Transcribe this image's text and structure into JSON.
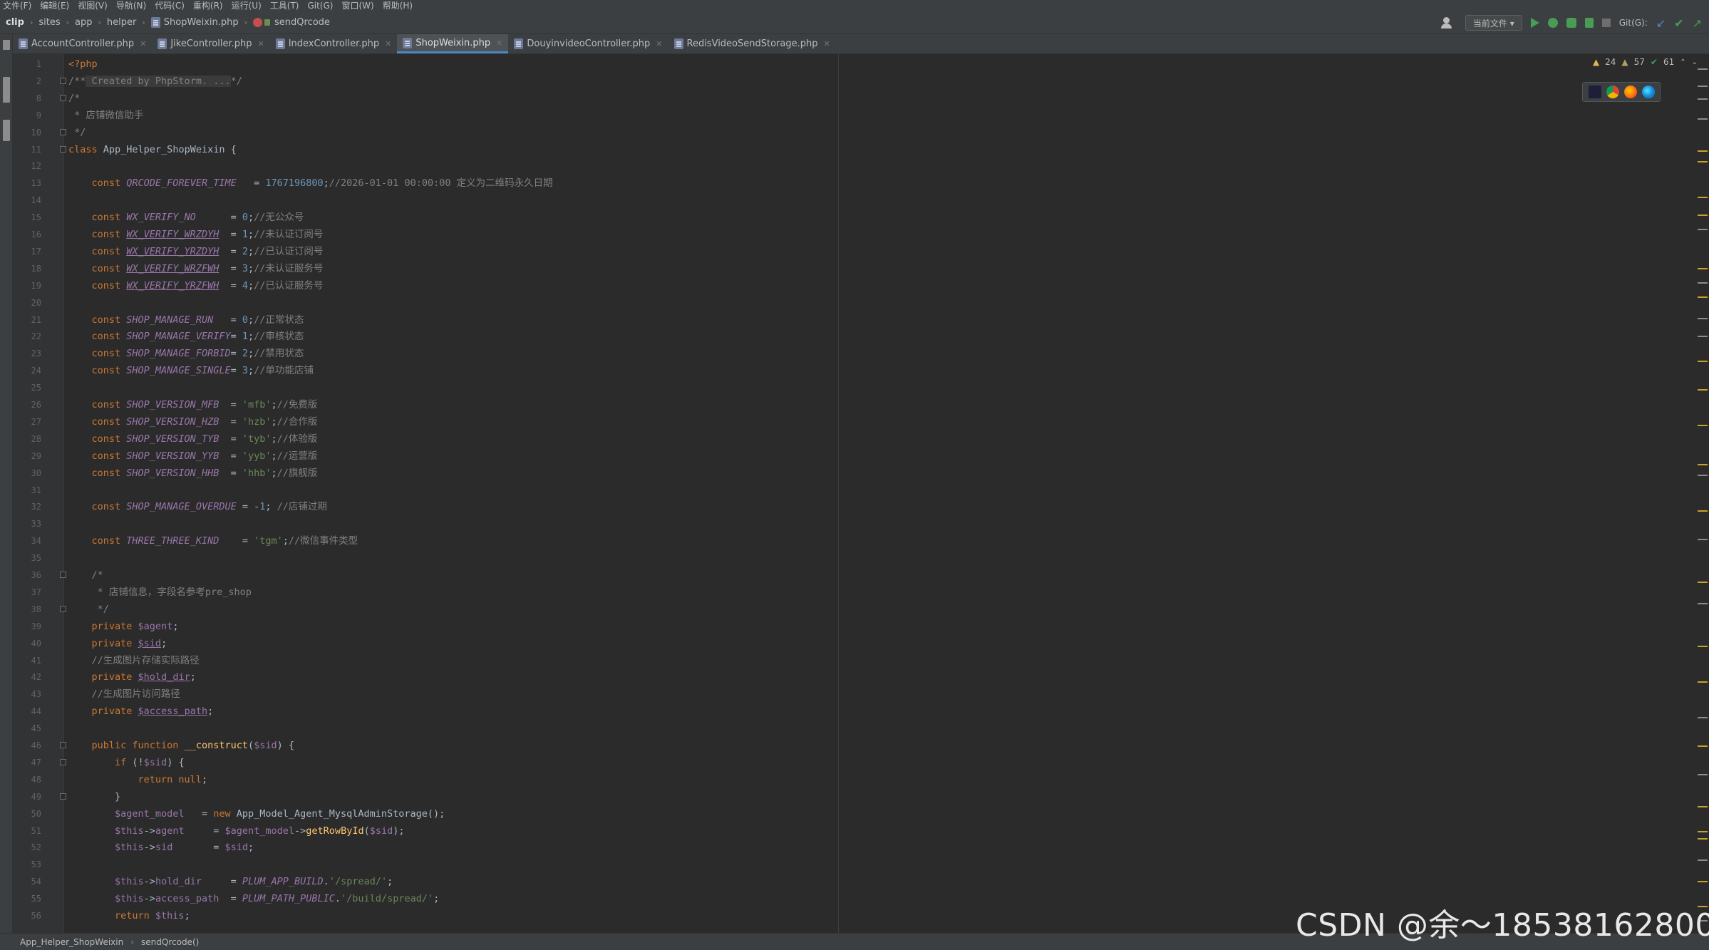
{
  "menu": [
    "文件(F)",
    "编辑(E)",
    "视图(V)",
    "导航(N)",
    "代码(C)",
    "重构(R)",
    "运行(U)",
    "工具(T)",
    "Git(G)",
    "窗口(W)",
    "帮助(H)"
  ],
  "breadcrumb": {
    "project": "clip",
    "path": [
      "sites",
      "app",
      "helper"
    ],
    "file": "ShopWeixin.php",
    "method": "sendQrcode"
  },
  "toolbar": {
    "run_config": "当前文件 ▾",
    "git_label": "Git(G):"
  },
  "tabs": [
    {
      "label": "AccountController.php",
      "active": false
    },
    {
      "label": "JikeController.php",
      "active": false
    },
    {
      "label": "IndexController.php",
      "active": false
    },
    {
      "label": "ShopWeixin.php",
      "active": true
    },
    {
      "label": "DouyinvideoController.php",
      "active": false
    },
    {
      "label": "RedisVideoSendStorage.php",
      "active": false
    }
  ],
  "inspections": {
    "warnings": "24",
    "weak_warnings": "57",
    "typos": "61"
  },
  "line_numbers": [
    "1",
    "2",
    "8",
    "9",
    "10",
    "11",
    "12",
    "13",
    "14",
    "15",
    "16",
    "17",
    "18",
    "19",
    "20",
    "21",
    "22",
    "23",
    "24",
    "25",
    "26",
    "27",
    "28",
    "29",
    "30",
    "31",
    "32",
    "33",
    "34",
    "35",
    "36",
    "37",
    "38",
    "39",
    "40",
    "41",
    "42",
    "43",
    "44",
    "45",
    "46",
    "47",
    "48",
    "49",
    "50",
    "51",
    "52",
    "53",
    "54",
    "55",
    "56"
  ],
  "code_lines": [
    [
      [
        "kw",
        "<?php"
      ]
    ],
    [
      [
        "cmt",
        "/**"
      ],
      [
        "fold-cmt",
        " Created by PhpStorm. ..."
      ],
      [
        "cmt",
        "*/"
      ]
    ],
    [
      [
        "cmt",
        "/*"
      ]
    ],
    [
      [
        "cmt",
        " * 店铺微信助手"
      ]
    ],
    [
      [
        "cmt",
        " */"
      ]
    ],
    [
      [
        "kw",
        "class "
      ],
      [
        "pt",
        "App_Helper_ShopWeixin {"
      ]
    ],
    [],
    [
      [
        "kw",
        "    const "
      ],
      [
        "cst",
        "QRCODE_FOREVER_TIME"
      ],
      [
        "pt",
        "   = "
      ],
      [
        "num",
        "1767196800"
      ],
      [
        "pt",
        ";"
      ],
      [
        "cmt",
        "//2026-01-01 00:00:00 定义为二维码永久日期"
      ]
    ],
    [],
    [
      [
        "kw",
        "    const "
      ],
      [
        "cst",
        "WX_VERIFY_NO"
      ],
      [
        "pt",
        "      = "
      ],
      [
        "num",
        "0"
      ],
      [
        "pt",
        ";"
      ],
      [
        "cmt",
        "//无公众号"
      ]
    ],
    [
      [
        "kw",
        "    const "
      ],
      [
        "cst und",
        "WX_VERIFY_WRZDYH"
      ],
      [
        "pt",
        "  = "
      ],
      [
        "num",
        "1"
      ],
      [
        "pt",
        ";"
      ],
      [
        "cmt",
        "//未认证订阅号"
      ]
    ],
    [
      [
        "kw",
        "    const "
      ],
      [
        "cst und",
        "WX_VERIFY_YRZDYH"
      ],
      [
        "pt",
        "  = "
      ],
      [
        "num",
        "2"
      ],
      [
        "pt",
        ";"
      ],
      [
        "cmt",
        "//已认证订阅号"
      ]
    ],
    [
      [
        "kw",
        "    const "
      ],
      [
        "cst und",
        "WX_VERIFY_WRZFWH"
      ],
      [
        "pt",
        "  = "
      ],
      [
        "num",
        "3"
      ],
      [
        "pt",
        ";"
      ],
      [
        "cmt",
        "//未认证服务号"
      ]
    ],
    [
      [
        "kw",
        "    const "
      ],
      [
        "cst und",
        "WX_VERIFY_YRZFWH"
      ],
      [
        "pt",
        "  = "
      ],
      [
        "num",
        "4"
      ],
      [
        "pt",
        ";"
      ],
      [
        "cmt",
        "//已认证服务号"
      ]
    ],
    [],
    [
      [
        "kw",
        "    const "
      ],
      [
        "cst",
        "SHOP_MANAGE_RUN"
      ],
      [
        "pt",
        "   = "
      ],
      [
        "num",
        "0"
      ],
      [
        "pt",
        ";"
      ],
      [
        "cmt",
        "//正常状态"
      ]
    ],
    [
      [
        "kw",
        "    const "
      ],
      [
        "cst",
        "SHOP_MANAGE_VERIFY"
      ],
      [
        "pt",
        "= "
      ],
      [
        "num",
        "1"
      ],
      [
        "pt",
        ";"
      ],
      [
        "cmt",
        "//审核状态"
      ]
    ],
    [
      [
        "kw",
        "    const "
      ],
      [
        "cst",
        "SHOP_MANAGE_FORBID"
      ],
      [
        "pt",
        "= "
      ],
      [
        "num",
        "2"
      ],
      [
        "pt",
        ";"
      ],
      [
        "cmt",
        "//禁用状态"
      ]
    ],
    [
      [
        "kw",
        "    const "
      ],
      [
        "cst",
        "SHOP_MANAGE_SINGLE"
      ],
      [
        "pt",
        "= "
      ],
      [
        "num",
        "3"
      ],
      [
        "pt",
        ";"
      ],
      [
        "cmt",
        "//单功能店铺"
      ]
    ],
    [],
    [
      [
        "kw",
        "    const "
      ],
      [
        "cst",
        "SHOP_VERSION_MFB"
      ],
      [
        "pt",
        "  = "
      ],
      [
        "str",
        "'mfb'"
      ],
      [
        "pt",
        ";"
      ],
      [
        "cmt",
        "//免费版"
      ]
    ],
    [
      [
        "kw",
        "    const "
      ],
      [
        "cst",
        "SHOP_VERSION_HZB"
      ],
      [
        "pt",
        "  = "
      ],
      [
        "str",
        "'hzb'"
      ],
      [
        "pt",
        ";"
      ],
      [
        "cmt",
        "//合作版"
      ]
    ],
    [
      [
        "kw",
        "    const "
      ],
      [
        "cst",
        "SHOP_VERSION_TYB"
      ],
      [
        "pt",
        "  = "
      ],
      [
        "str",
        "'tyb'"
      ],
      [
        "pt",
        ";"
      ],
      [
        "cmt",
        "//体验版"
      ]
    ],
    [
      [
        "kw",
        "    const "
      ],
      [
        "cst",
        "SHOP_VERSION_YYB"
      ],
      [
        "pt",
        "  = "
      ],
      [
        "str",
        "'yyb'"
      ],
      [
        "pt",
        ";"
      ],
      [
        "cmt",
        "//运营版"
      ]
    ],
    [
      [
        "kw",
        "    const "
      ],
      [
        "cst",
        "SHOP_VERSION_HHB"
      ],
      [
        "pt",
        "  = "
      ],
      [
        "str",
        "'hhb'"
      ],
      [
        "pt",
        ";"
      ],
      [
        "cmt",
        "//旗舰版"
      ]
    ],
    [],
    [
      [
        "kw",
        "    const "
      ],
      [
        "cst",
        "SHOP_MANAGE_OVERDUE"
      ],
      [
        "pt",
        " = -"
      ],
      [
        "num",
        "1"
      ],
      [
        "pt",
        "; "
      ],
      [
        "cmt",
        "//店铺过期"
      ]
    ],
    [],
    [
      [
        "kw",
        "    const "
      ],
      [
        "cst",
        "THREE_THREE_KIND"
      ],
      [
        "pt",
        "    = "
      ],
      [
        "str",
        "'tgm'"
      ],
      [
        "pt",
        ";"
      ],
      [
        "cmt",
        "//微信事件类型"
      ]
    ],
    [],
    [
      [
        "cmt",
        "    /*"
      ]
    ],
    [
      [
        "cmt",
        "     * 店铺信息，字段名参考pre_shop"
      ]
    ],
    [
      [
        "cmt",
        "     */"
      ]
    ],
    [
      [
        "kw",
        "    private "
      ],
      [
        "var",
        "$agent"
      ],
      [
        "pt",
        ";"
      ]
    ],
    [
      [
        "kw",
        "    private "
      ],
      [
        "var und",
        "$sid"
      ],
      [
        "pt",
        ";"
      ]
    ],
    [
      [
        "cmt",
        "    //生成图片存储实际路径"
      ]
    ],
    [
      [
        "kw",
        "    private "
      ],
      [
        "var und",
        "$hold_dir"
      ],
      [
        "pt",
        ";"
      ]
    ],
    [
      [
        "cmt",
        "    //生成图片访问路径"
      ]
    ],
    [
      [
        "kw",
        "    private "
      ],
      [
        "var und",
        "$access_path"
      ],
      [
        "pt",
        ";"
      ]
    ],
    [],
    [
      [
        "kw",
        "    public function "
      ],
      [
        "fn",
        "__construct"
      ],
      [
        "pt",
        "("
      ],
      [
        "var",
        "$sid"
      ],
      [
        "pt",
        ") {"
      ]
    ],
    [
      [
        "kw",
        "        if "
      ],
      [
        "pt",
        "(!"
      ],
      [
        "var",
        "$sid"
      ],
      [
        "pt",
        ") {"
      ]
    ],
    [
      [
        "kw",
        "            return null"
      ],
      [
        "pt",
        ";"
      ]
    ],
    [
      [
        "pt",
        "        }"
      ]
    ],
    [
      [
        "var",
        "        $agent_model"
      ],
      [
        "pt",
        "   = "
      ],
      [
        "kw",
        "new "
      ],
      [
        "pt",
        "App_Model_Agent_MysqlAdminStorage();"
      ]
    ],
    [
      [
        "var",
        "        $this"
      ],
      [
        "pt",
        "->"
      ],
      [
        "var",
        "agent"
      ],
      [
        "pt",
        "     = "
      ],
      [
        "var",
        "$agent_model"
      ],
      [
        "pt",
        "->"
      ],
      [
        "fn",
        "getRowById"
      ],
      [
        "pt",
        "("
      ],
      [
        "var",
        "$sid"
      ],
      [
        "pt",
        ");"
      ]
    ],
    [
      [
        "var",
        "        $this"
      ],
      [
        "pt",
        "->"
      ],
      [
        "var",
        "sid"
      ],
      [
        "pt",
        "       = "
      ],
      [
        "var",
        "$sid"
      ],
      [
        "pt",
        ";"
      ]
    ],
    [],
    [
      [
        "var",
        "        $this"
      ],
      [
        "pt",
        "->"
      ],
      [
        "var",
        "hold_dir"
      ],
      [
        "pt",
        "     = "
      ],
      [
        "cst",
        "PLUM_APP_BUILD"
      ],
      [
        "pt",
        "."
      ],
      [
        "str",
        "'/spread/'"
      ],
      [
        "pt",
        ";"
      ]
    ],
    [
      [
        "var",
        "        $this"
      ],
      [
        "pt",
        "->"
      ],
      [
        "var",
        "access_path"
      ],
      [
        "pt",
        "  = "
      ],
      [
        "cst",
        "PLUM_PATH_PUBLIC"
      ],
      [
        "pt",
        "."
      ],
      [
        "str",
        "'/build/spread/'"
      ],
      [
        "pt",
        ";"
      ]
    ],
    [
      [
        "kw",
        "        return "
      ],
      [
        "var",
        "$this"
      ],
      [
        "pt",
        ";"
      ]
    ]
  ],
  "status": {
    "class_crumb": "App_Helper_ShopWeixin",
    "method_crumb": "sendQrcode()"
  },
  "watermark": "CSDN @余～18538162800",
  "colors": {
    "editor_bg": "#2b2b2b",
    "keyword": "#cc7832",
    "constant": "#9876aa",
    "number": "#6897bb",
    "string": "#6a8759",
    "comment": "#808080",
    "accent": "#4a88c7"
  }
}
